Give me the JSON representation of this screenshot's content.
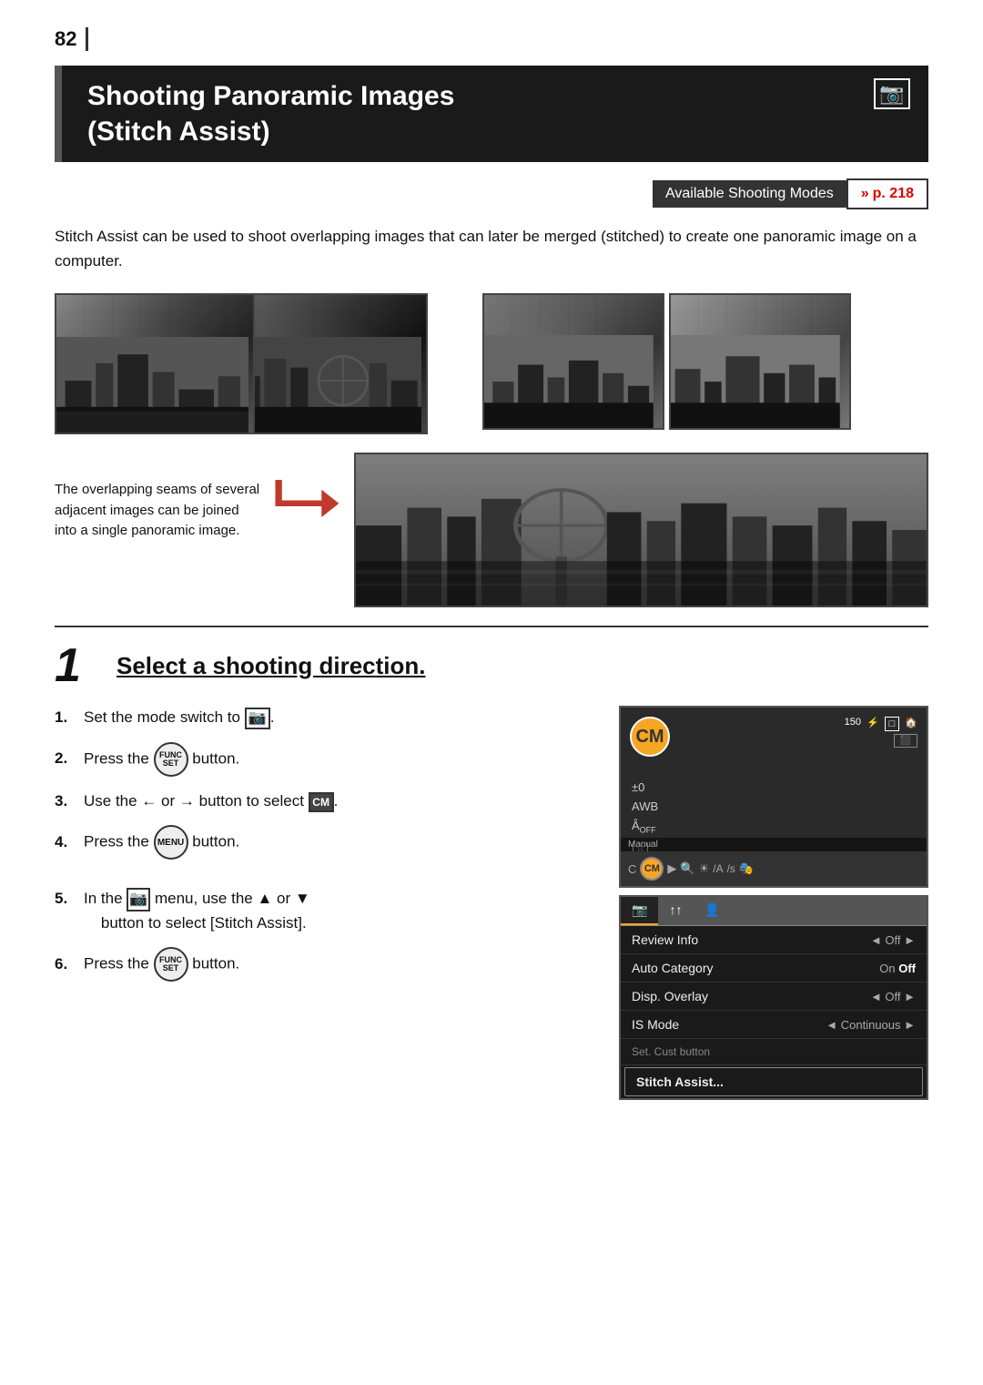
{
  "page": {
    "number": "82",
    "section_bar_char": "|"
  },
  "header": {
    "title_line1": "Shooting Panoramic Images",
    "title_line2": "(Stitch Assist)",
    "camera_icon": "📷"
  },
  "modes_bar": {
    "label": "Available Shooting Modes",
    "link_arrows": "»",
    "link_page": "p. 218"
  },
  "intro": {
    "text": "Stitch Assist can be used to shoot overlapping images that can later be merged (stitched) to create one panoramic image on a computer."
  },
  "illustration": {
    "overlap_text_line1": "The overlapping seams of several",
    "overlap_text_line2": "adjacent images can be joined",
    "overlap_text_line3": "into a single panoramic image."
  },
  "step1": {
    "number": "1",
    "title": "Select a shooting direction.",
    "items": [
      {
        "num": "1.",
        "text": "Set the mode switch to",
        "icon": "camera"
      },
      {
        "num": "2.",
        "text": "Press the",
        "icon": "func",
        "text2": "button."
      },
      {
        "num": "3.",
        "text": "Use the ← or → button to select",
        "icon": "cm_box"
      },
      {
        "num": "4.",
        "text": "Press the",
        "icon": "menu",
        "text2": "button."
      },
      {
        "num": "5.",
        "text": "In the",
        "icon": "shoot_icon",
        "text2": "menu, use the ▲ or ▼ button to select [Stitch Assist]."
      },
      {
        "num": "6.",
        "text": "Press the",
        "icon": "func",
        "text2": "button."
      }
    ]
  },
  "cam_screen": {
    "top_icons": [
      "150 ⚡",
      "□ 🏠",
      "⬛"
    ],
    "cm_label": "CM",
    "left_icons": [
      "±0",
      "AWB",
      "Âoff",
      "☆"
    ],
    "manual_label": "Manual",
    "bottom_modes": [
      "C",
      "CM",
      "▶",
      "🔍",
      "☀",
      "/A",
      "/s",
      "🎭"
    ]
  },
  "cam_menu": {
    "tabs": [
      "📷",
      "↑↑",
      "👤"
    ],
    "rows": [
      {
        "label": "Review Info",
        "value": "◄ Off",
        "arrow": "►"
      },
      {
        "label": "Auto Category",
        "value": "On Off",
        "arrow": ""
      },
      {
        "label": "Disp. Overlay",
        "value": "◄ Off",
        "arrow": "►"
      },
      {
        "label": "IS Mode",
        "value": "◄ Continuous",
        "arrow": "►"
      },
      {
        "label": "Set. Cust button",
        "value": "",
        "arrow": ""
      },
      {
        "label": "Stitch Assist...",
        "value": "",
        "arrow": "",
        "highlighted": true
      }
    ]
  },
  "or_connector": "or"
}
